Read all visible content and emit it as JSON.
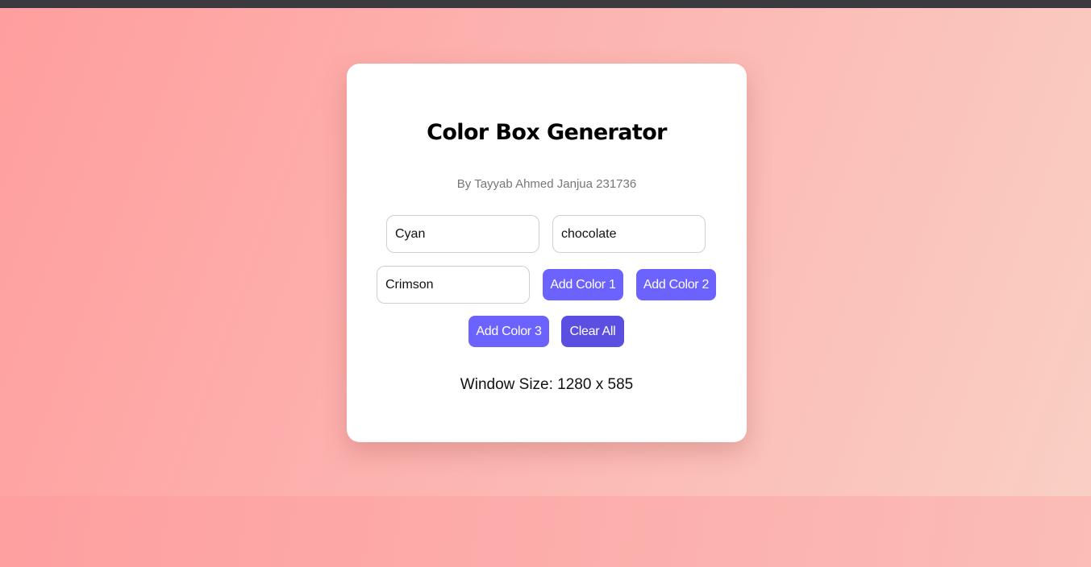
{
  "app": {
    "title": "Color Box Generator",
    "subtitle": "By Tayyab Ahmed Janjua 231736"
  },
  "inputs": {
    "color1": "Cyan",
    "color2": "chocolate",
    "color3": "Crimson"
  },
  "buttons": {
    "add_color_1": "Add Color 1",
    "add_color_2": "Add Color 2",
    "add_color_3": "Add Color 3",
    "clear_all": "Clear All"
  },
  "status": {
    "window_size": "Window Size: 1280 x 585"
  },
  "colors": {
    "accent": "#6c63ff",
    "accent_dark": "#5a4fe0",
    "background_start": "#ff9e9e",
    "background_end": "#f9cfc4"
  }
}
